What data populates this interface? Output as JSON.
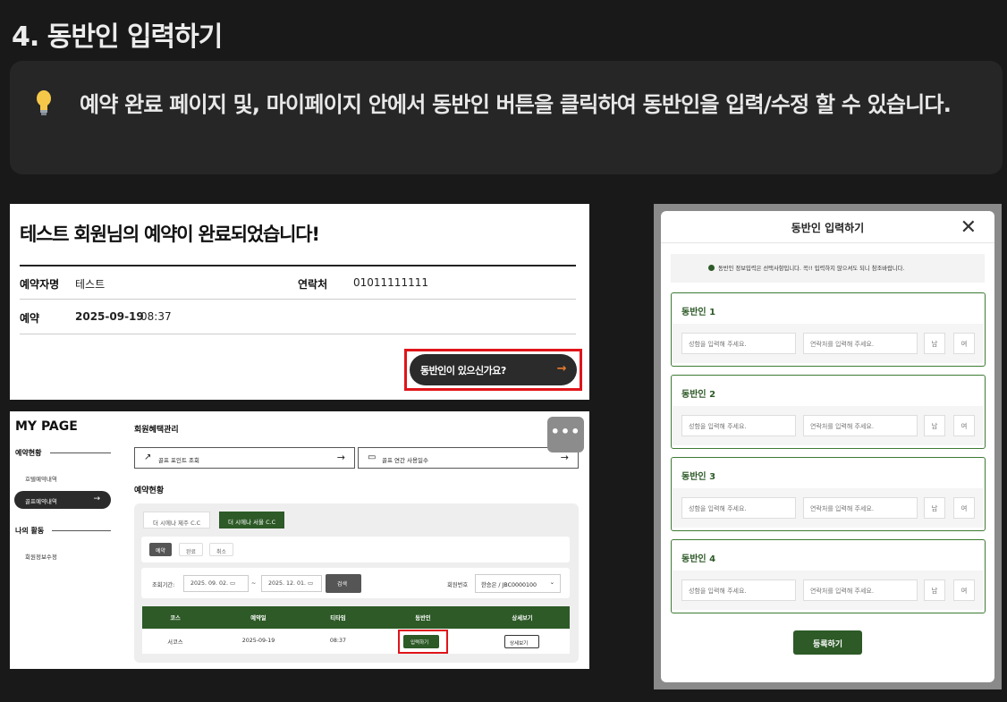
{
  "heading": "4. 동반인 입력하기",
  "callout": {
    "icon": "lightbulb-icon",
    "text": "예약 완료 페이지 및, 마이페이지 안에서 동반인 버튼을 클릭하여 동반인을 입력/수정 할 수 있습니다."
  },
  "complete": {
    "title": "테스트 회원님의 예약이 완료되었습니다!",
    "booker_label": "예약자명",
    "booker_value": "테스트",
    "contact_label": "연락처",
    "contact_value": "01011111111",
    "reserve_label": "예약",
    "reserve_date": "2025-09-19",
    "reserve_time": "08:37",
    "companion_button": "동반인이 있으신가요?",
    "arrow": "→"
  },
  "mypage": {
    "title": "MY PAGE",
    "group1": "예약현황",
    "item_hotel": "호텔예약내역",
    "item_golf": "골프예약내역",
    "group2": "나의 활동",
    "item_member": "회원정보수정",
    "section1": "회원혜택관리",
    "link1": "골프 포인트 조회",
    "link2": "골프 연간 사용일수",
    "section2": "예약현황",
    "tab1": "더 시에나 제주 C.C",
    "tab2": "더 시에나 서울 C.C",
    "chip1": "예약",
    "chip2": "완료",
    "chip3": "취소",
    "period_label": "조회기간:",
    "date_from": "2025. 09. 02.",
    "tilde": "~",
    "date_to": "2025. 12. 01.",
    "search": "검색",
    "member_label": "회원번호",
    "member_value": "한승은 / JBC0000100",
    "columns": [
      "코스",
      "예약일",
      "티타임",
      "동반인",
      "상세보기"
    ],
    "row": {
      "course": "서코스",
      "date": "2025-09-19",
      "time": "08:37",
      "input_btn": "입력하기",
      "detail_btn": "상세보기"
    },
    "more": "•••"
  },
  "modal": {
    "title": "동반인 입력하기",
    "notice": "동반인 정보입력은 선택사항입니다. 꼭!! 입력하지 않으셔도 되니 참조바랍니다.",
    "companions": [
      {
        "label": "동반인 1"
      },
      {
        "label": "동반인 2"
      },
      {
        "label": "동반인 3"
      },
      {
        "label": "동반인 4"
      }
    ],
    "name_placeholder": "성함을 입력해 주세요.",
    "phone_placeholder": "연락처를 입력해 주세요.",
    "male": "남",
    "female": "여",
    "submit": "등록하기"
  },
  "colors": {
    "accent_green": "#2d5a27",
    "highlight_red": "#e0141a"
  }
}
